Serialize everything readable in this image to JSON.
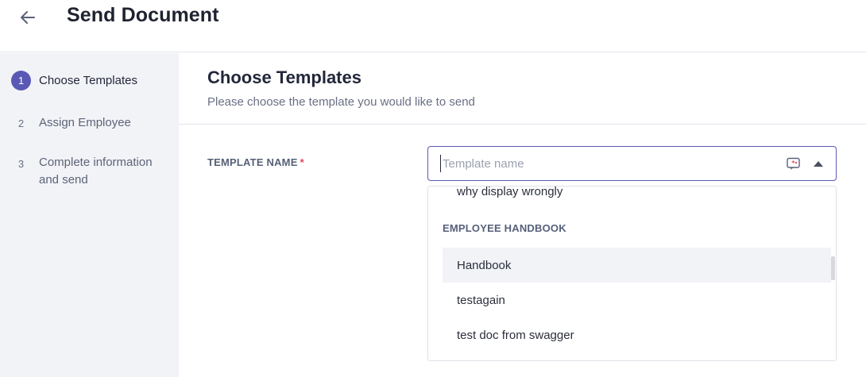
{
  "header": {
    "title": "Send Document",
    "back_icon": "arrow-left-icon"
  },
  "sidebar": {
    "steps": [
      {
        "number": "1",
        "label": "Choose Templates",
        "active": true
      },
      {
        "number": "2",
        "label": "Assign Employee",
        "active": false
      },
      {
        "number": "3",
        "label_line1": "Complete information",
        "label_line2": "and send",
        "active": false
      }
    ]
  },
  "main": {
    "title": "Choose Templates",
    "subtitle": "Please choose the template you would like to send",
    "field": {
      "label": "TEMPLATE NAME",
      "required_mark": "*",
      "value": "",
      "placeholder": "Template name"
    },
    "dropdown": {
      "items_top": [
        "why display wrongly"
      ],
      "group": "EMPLOYEE HANDBOOK",
      "items": [
        {
          "label": "Handbook",
          "highlighted": true
        },
        {
          "label": "testagain",
          "highlighted": false
        },
        {
          "label": "test doc from swagger",
          "highlighted": false
        }
      ]
    }
  },
  "colors": {
    "accent": "#5a58b5",
    "sidebar_bg": "#f2f3f7",
    "required": "#e0455a"
  }
}
